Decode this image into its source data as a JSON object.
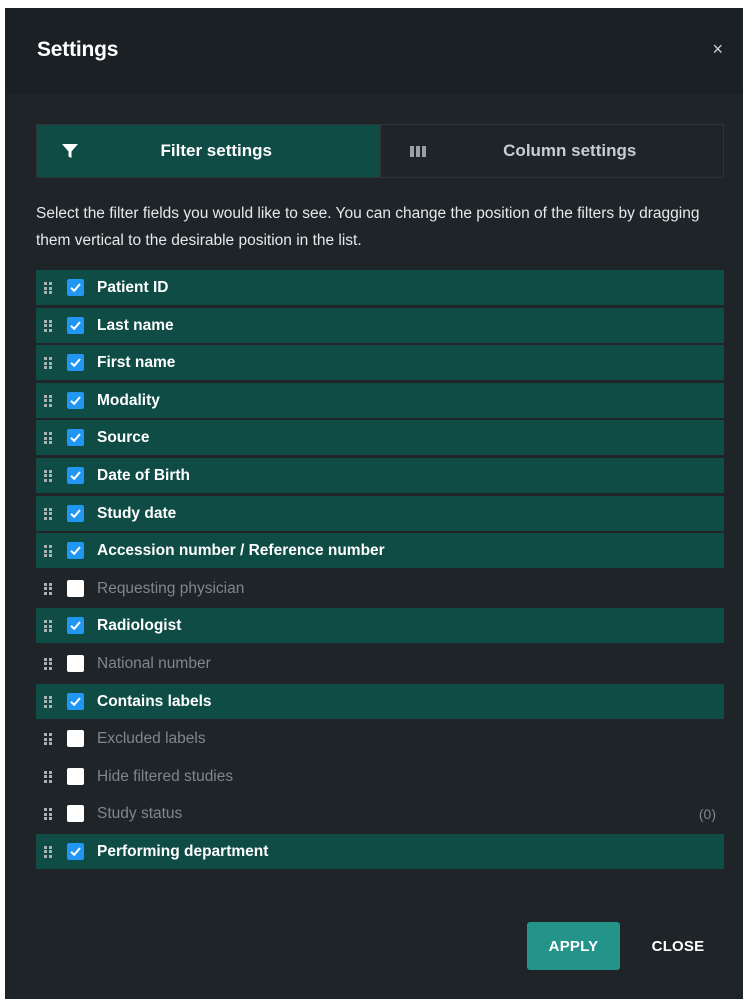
{
  "dialog": {
    "title": "Settings",
    "close_glyph": "×"
  },
  "tabs": [
    {
      "label": "Filter settings",
      "icon": "filter-icon",
      "active": true
    },
    {
      "label": "Column settings",
      "icon": "columns-icon",
      "active": false
    }
  ],
  "description": "Select the filter fields you would like to see. You can change the position of the filters by dragging them vertical to the desirable position in the list.",
  "filters": [
    {
      "label": "Patient ID",
      "checked": true
    },
    {
      "label": "Last name",
      "checked": true
    },
    {
      "label": "First name",
      "checked": true
    },
    {
      "label": "Modality",
      "checked": true
    },
    {
      "label": "Source",
      "checked": true
    },
    {
      "label": "Date of Birth",
      "checked": true
    },
    {
      "label": "Study date",
      "checked": true
    },
    {
      "label": "Accession number / Reference number",
      "checked": true
    },
    {
      "label": "Requesting physician",
      "checked": false
    },
    {
      "label": "Radiologist",
      "checked": true
    },
    {
      "label": "National number",
      "checked": false
    },
    {
      "label": "Contains labels",
      "checked": true
    },
    {
      "label": "Excluded labels",
      "checked": false
    },
    {
      "label": "Hide filtered studies",
      "checked": false
    },
    {
      "label": "Study status",
      "checked": false,
      "count": "(0)"
    },
    {
      "label": "Performing department",
      "checked": true
    }
  ],
  "footer": {
    "apply_label": "APPLY",
    "close_label": "CLOSE"
  },
  "colors": {
    "accent": "#0f4c45",
    "apply_button": "#24938a",
    "checkbox": "#2196f3",
    "background": "#1e2428"
  }
}
